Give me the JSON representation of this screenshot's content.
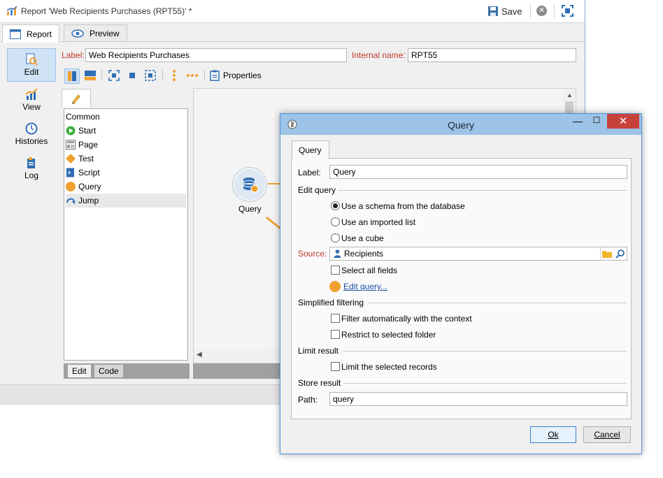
{
  "window": {
    "title": "Report 'Web Recipients Purchases (RPT55)' *",
    "save_label": "Save"
  },
  "tabs": [
    {
      "label": "Report"
    },
    {
      "label": "Preview"
    }
  ],
  "left_nav": [
    {
      "label": "Edit"
    },
    {
      "label": "View"
    },
    {
      "label": "Histories"
    },
    {
      "label": "Log"
    }
  ],
  "form": {
    "label_caption": "Label:",
    "label_value": "Web Recipients Purchases",
    "internal_name_caption": "Internal name:",
    "internal_name_value": "RPT55"
  },
  "toolbar": {
    "properties_label": "Properties"
  },
  "palette": {
    "group": "Common",
    "items": [
      {
        "label": "Start"
      },
      {
        "label": "Page"
      },
      {
        "label": "Test"
      },
      {
        "label": "Script"
      },
      {
        "label": "Query"
      },
      {
        "label": "Jump"
      }
    ],
    "bottom_tabs": [
      {
        "label": "Edit"
      },
      {
        "label": "Code"
      }
    ]
  },
  "canvas": {
    "node_label": "Query"
  },
  "dialog": {
    "title": "Query",
    "tab": "Query",
    "label_caption": "Label:",
    "label_value": "Query",
    "edit_query_section": "Edit query",
    "radios": [
      {
        "label": "Use a schema from the database",
        "selected": true
      },
      {
        "label": "Use an imported list",
        "selected": false
      },
      {
        "label": "Use a cube",
        "selected": false
      }
    ],
    "source_caption": "Source:",
    "source_value": "Recipients",
    "select_all_fields": "Select all fields",
    "edit_query_link": "Edit query...",
    "simplified_filtering_section": "Simplified filtering",
    "filter_context": "Filter automatically with the context",
    "restrict_folder": "Restrict to selected folder",
    "limit_result_section": "Limit result",
    "limit_records": "Limit the selected records",
    "store_result_section": "Store result",
    "path_caption": "Path:",
    "path_value": "query",
    "ok_label": "Ok",
    "cancel_label": "Cancel"
  },
  "colors": {
    "accent_orange": "#f0a030",
    "label_red": "#c0392b",
    "selection_blue": "#cfe2f6",
    "dialog_title_blue": "#9dc3e6",
    "close_red": "#c7413b",
    "link_blue": "#1a4fa0"
  }
}
